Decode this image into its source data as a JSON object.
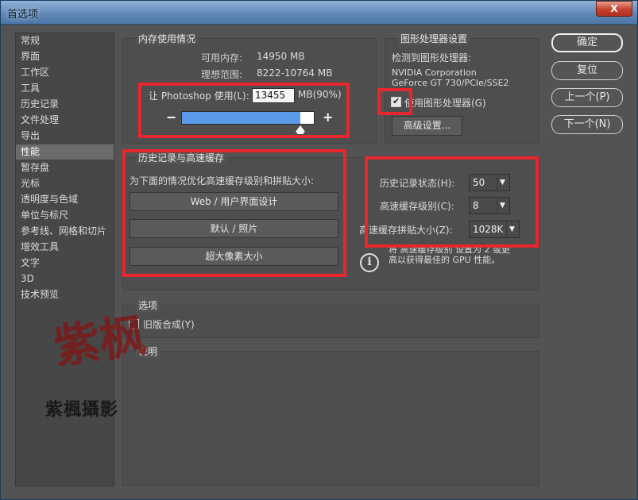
{
  "window": {
    "title": "首选项",
    "close_label": "X"
  },
  "sidebar": {
    "items": [
      "常规",
      "界面",
      "工作区",
      "工具",
      "历史记录",
      "文件处理",
      "导出",
      "性能",
      "暂存盘",
      "光标",
      "透明度与色域",
      "单位与标尺",
      "参考线、网格和切片",
      "增效工具",
      "文字",
      "3D",
      "技术预览"
    ],
    "active_index": 7
  },
  "memory": {
    "title": "内存使用情况",
    "available_label": "可用内存:",
    "available_value": "14950 MB",
    "ideal_label": "理想范围:",
    "ideal_value": "8222-10764 MB",
    "let_label": "让 Photoshop 使用(L):",
    "use_value": "13455",
    "unit_label": "MB(90%)",
    "slider_fraction": 0.9,
    "minus": "−",
    "plus": "+"
  },
  "gpu": {
    "title": "图形处理器设置",
    "detected_label": "检测到图形处理器:",
    "vendor": "NVIDIA Corporation",
    "model": "GeForce GT 730/PCIe/SSE2",
    "use_gpu_label": "使用图形处理器(G)",
    "use_gpu_checked": true,
    "advanced_button": "高级设置..."
  },
  "history_cache": {
    "title": "历史记录与高速缓存",
    "optimize_label": "为下面的情况优化高速缓存级别和拼贴大小:",
    "buttons": [
      "Web / 用户界面设计",
      "默认 / 照片",
      "超大像素大小"
    ],
    "history_states_label": "历史记录状态(H):",
    "history_states_value": "50",
    "cache_levels_label": "高速缓存级别(C):",
    "cache_levels_value": "8",
    "tile_size_label": "高速缓存拼贴大小(Z):",
    "tile_size_value": "1028K",
    "info_line1": "将 高速缓存级别 设置为 2 或更",
    "info_line2": "高以获得最佳的 GPU 性能。"
  },
  "options": {
    "title": "选项",
    "legacy_label": "旧版合成(Y)",
    "legacy_checked": false
  },
  "description": {
    "title": "说明"
  },
  "actions": {
    "ok": "确定",
    "reset": "复位",
    "prev": "上一个(P)",
    "next": "下一个(N)"
  },
  "watermark": {
    "big": "紫枫",
    "small": "紫楓攝影"
  },
  "colors": {
    "highlight_box": "#e8262d",
    "slider_fill": "#5b9ae8",
    "background": "#535353"
  }
}
